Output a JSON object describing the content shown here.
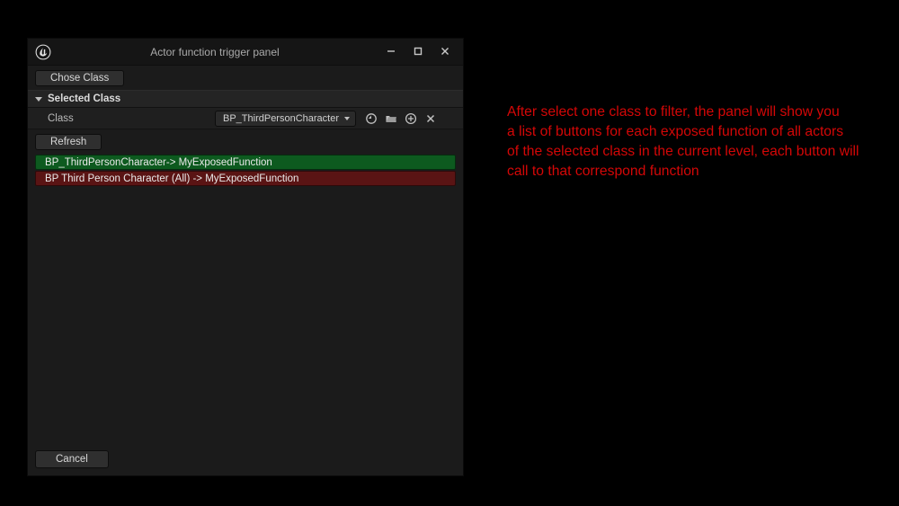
{
  "window": {
    "title": "Actor function trigger panel",
    "minimize_tooltip": "Minimize",
    "maximize_tooltip": "Maximize",
    "close_tooltip": "Close"
  },
  "toolbar": {
    "chose_class_label": "Chose Class"
  },
  "section": {
    "selected_class_header": "Selected Class"
  },
  "class_row": {
    "label": "Class",
    "selected_value": "BP_ThirdPersonCharacter",
    "browse_tooltip": "Browse",
    "folder_tooltip": "Open",
    "new_tooltip": "Create New",
    "clear_tooltip": "Clear"
  },
  "refresh": {
    "label": "Refresh"
  },
  "functions": [
    {
      "label": "BP_ThirdPersonCharacter-> MyExposedFunction",
      "variant": "green"
    },
    {
      "label": "BP Third Person Character (All) -> MyExposedFunction",
      "variant": "red"
    }
  ],
  "bottom": {
    "cancel_label": "Cancel"
  },
  "annotation": {
    "text": "After select one class to filter, the panel will show you\n a list of buttons for each exposed function of all actors\nof the selected class in the current level, each button will\n call to that correspond function"
  }
}
